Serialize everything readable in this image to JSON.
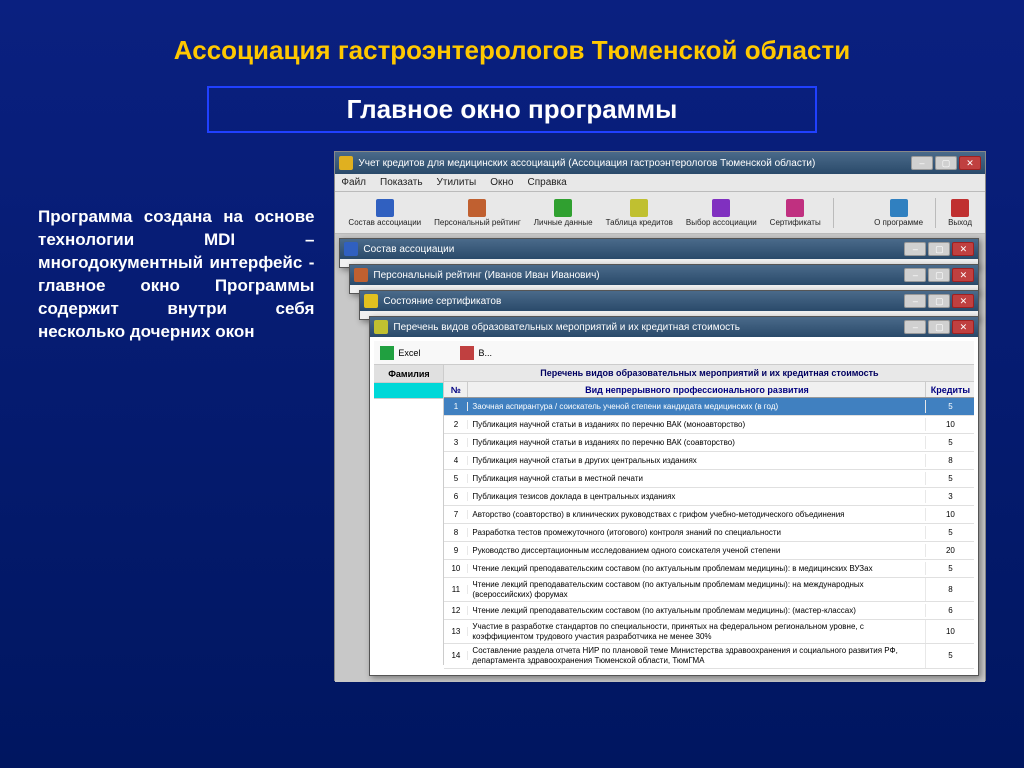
{
  "slide": {
    "title": "Ассоциация гастроэнтерологов Тюменской области",
    "subtitle": "Главное окно программы",
    "description": "Программа создана на основе технологии MDI – многодокументный интерфейс - главное окно Программы содержит внутри себя несколько дочерних окон"
  },
  "app": {
    "title": "Учет кредитов для медицинских ассоциаций (Ассоциация гастроэнтерологов Тюменской области)",
    "menu": [
      "Файл",
      "Показать",
      "Утилиты",
      "Окно",
      "Справка"
    ],
    "toolbar": [
      {
        "label": "Состав ассоциации",
        "color": "#3060c0"
      },
      {
        "label": "Персональный рейтинг",
        "color": "#c06030"
      },
      {
        "label": "Личные данные",
        "color": "#30a030"
      },
      {
        "label": "Таблица кредитов",
        "color": "#c0c030"
      },
      {
        "label": "Выбор ассоциации",
        "color": "#8030c0"
      },
      {
        "label": "Сертификаты",
        "color": "#c03080"
      }
    ],
    "toolbar_right": [
      {
        "label": "О программе",
        "color": "#3080c0"
      },
      {
        "label": "Выход",
        "color": "#c03030"
      }
    ],
    "children": {
      "w1": "Состав ассоциации",
      "w2": "Персональный рейтинг (Иванов Иван Иванович)",
      "w3": "Состояние сертификатов",
      "w4": "Перечень видов образовательных мероприятий и их кредитная стоимость"
    },
    "subbar": {
      "excel": "Excel",
      "back": "В..."
    },
    "leftcol": {
      "header": "Фамилия"
    },
    "table": {
      "title": "Перечень видов образовательных мероприятий и их кредитная стоимость",
      "headers": {
        "num": "№",
        "desc": "Вид непрерывного профессионального развития",
        "credits": "Кредиты"
      },
      "rows": [
        {
          "n": 1,
          "d": "Заочная аспирантура / соискатель ученой степени кандидата медицинских (в год)",
          "k": 5
        },
        {
          "n": 2,
          "d": "Публикация научной статьи в изданиях по перечню ВАК (моноавторство)",
          "k": 10
        },
        {
          "n": 3,
          "d": "Публикация научной статьи в изданиях по перечню ВАК (соавторство)",
          "k": 5
        },
        {
          "n": 4,
          "d": "Публикация научной статьи в других центральных изданиях",
          "k": 8
        },
        {
          "n": 5,
          "d": "Публикация научной статьи в местной печати",
          "k": 5
        },
        {
          "n": 6,
          "d": "Публикация тезисов доклада в центральных изданиях",
          "k": 3
        },
        {
          "n": 7,
          "d": "Авторство (соавторство) в клинических руководствах с грифом учебно-методического объединения",
          "k": 10
        },
        {
          "n": 8,
          "d": "Разработка тестов промежуточного (итогового) контроля знаний по специальности",
          "k": 5
        },
        {
          "n": 9,
          "d": "Руководство диссертационным исследованием одного соискателя ученой степени",
          "k": 20
        },
        {
          "n": 10,
          "d": "Чтение лекций преподавательским составом (по актуальным проблемам медицины): в медицинских ВУЗах",
          "k": 5
        },
        {
          "n": 11,
          "d": "Чтение лекций преподавательским составом (по актуальным проблемам медицины): на международных (всероссийских) форумах",
          "k": 8
        },
        {
          "n": 12,
          "d": "Чтение лекций преподавательским составом (по актуальным проблемам медицины): (мастер-классах)",
          "k": 6
        },
        {
          "n": 13,
          "d": "Участие в разработке стандартов по специальности, принятых на федеральном региональном уровне, с коэффициентом трудового участия разработчика не менее 30%",
          "k": 10
        },
        {
          "n": 14,
          "d": "Составление раздела отчета НИР по плановой теме Министерства здравоохранения и социального развития РФ, департамента здравоохранения Тюменской области, ТюмГМА",
          "k": 5
        }
      ]
    }
  }
}
